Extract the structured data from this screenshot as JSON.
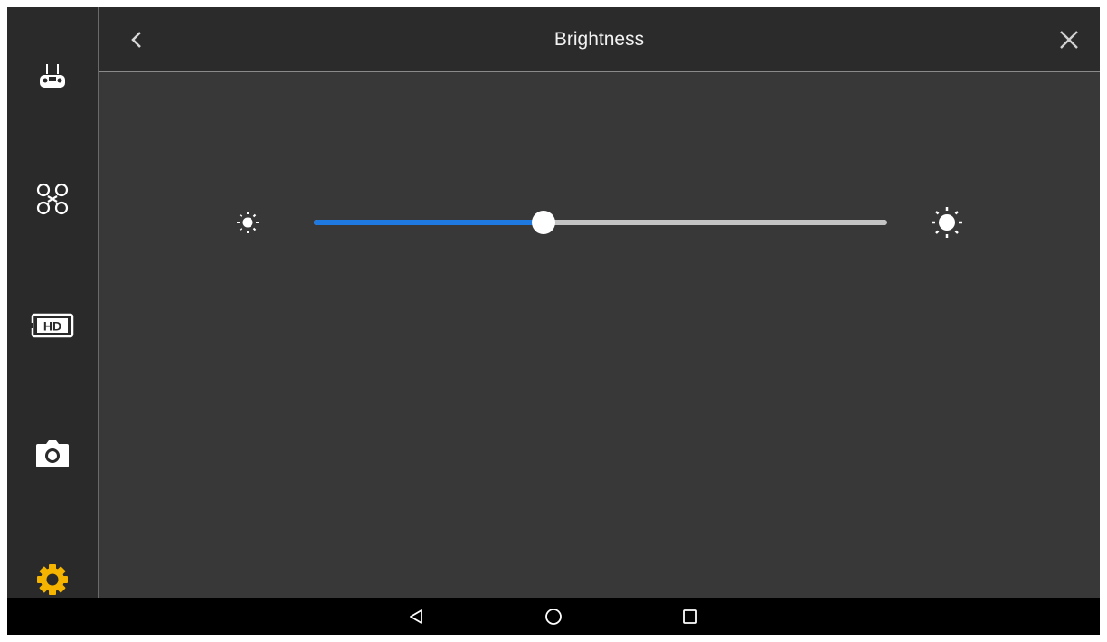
{
  "header": {
    "title": "Brightness",
    "back_icon": "chevron-left-icon",
    "close_icon": "close-icon"
  },
  "sidebar": {
    "items": [
      {
        "name": "remote-controller",
        "icon": "remote-controller-icon",
        "active": false
      },
      {
        "name": "aircraft",
        "icon": "drone-icon",
        "active": false
      },
      {
        "name": "hd-transmission",
        "icon": "hd-icon",
        "active": false
      },
      {
        "name": "camera",
        "icon": "camera-icon",
        "active": false
      },
      {
        "name": "general-settings",
        "icon": "gear-icon",
        "active": true
      }
    ]
  },
  "brightness": {
    "value_fraction": 0.4,
    "min_icon": "sun-small-icon",
    "max_icon": "sun-large-icon"
  },
  "navbar": {
    "buttons": [
      "back-triangle-icon",
      "home-circle-icon",
      "recents-square-icon"
    ]
  },
  "colors": {
    "accent": "#1e7ae0",
    "active_icon": "#f5b400",
    "track": "#c4c4c4",
    "background": "#383838",
    "sidebar": "#2a2a2a"
  }
}
